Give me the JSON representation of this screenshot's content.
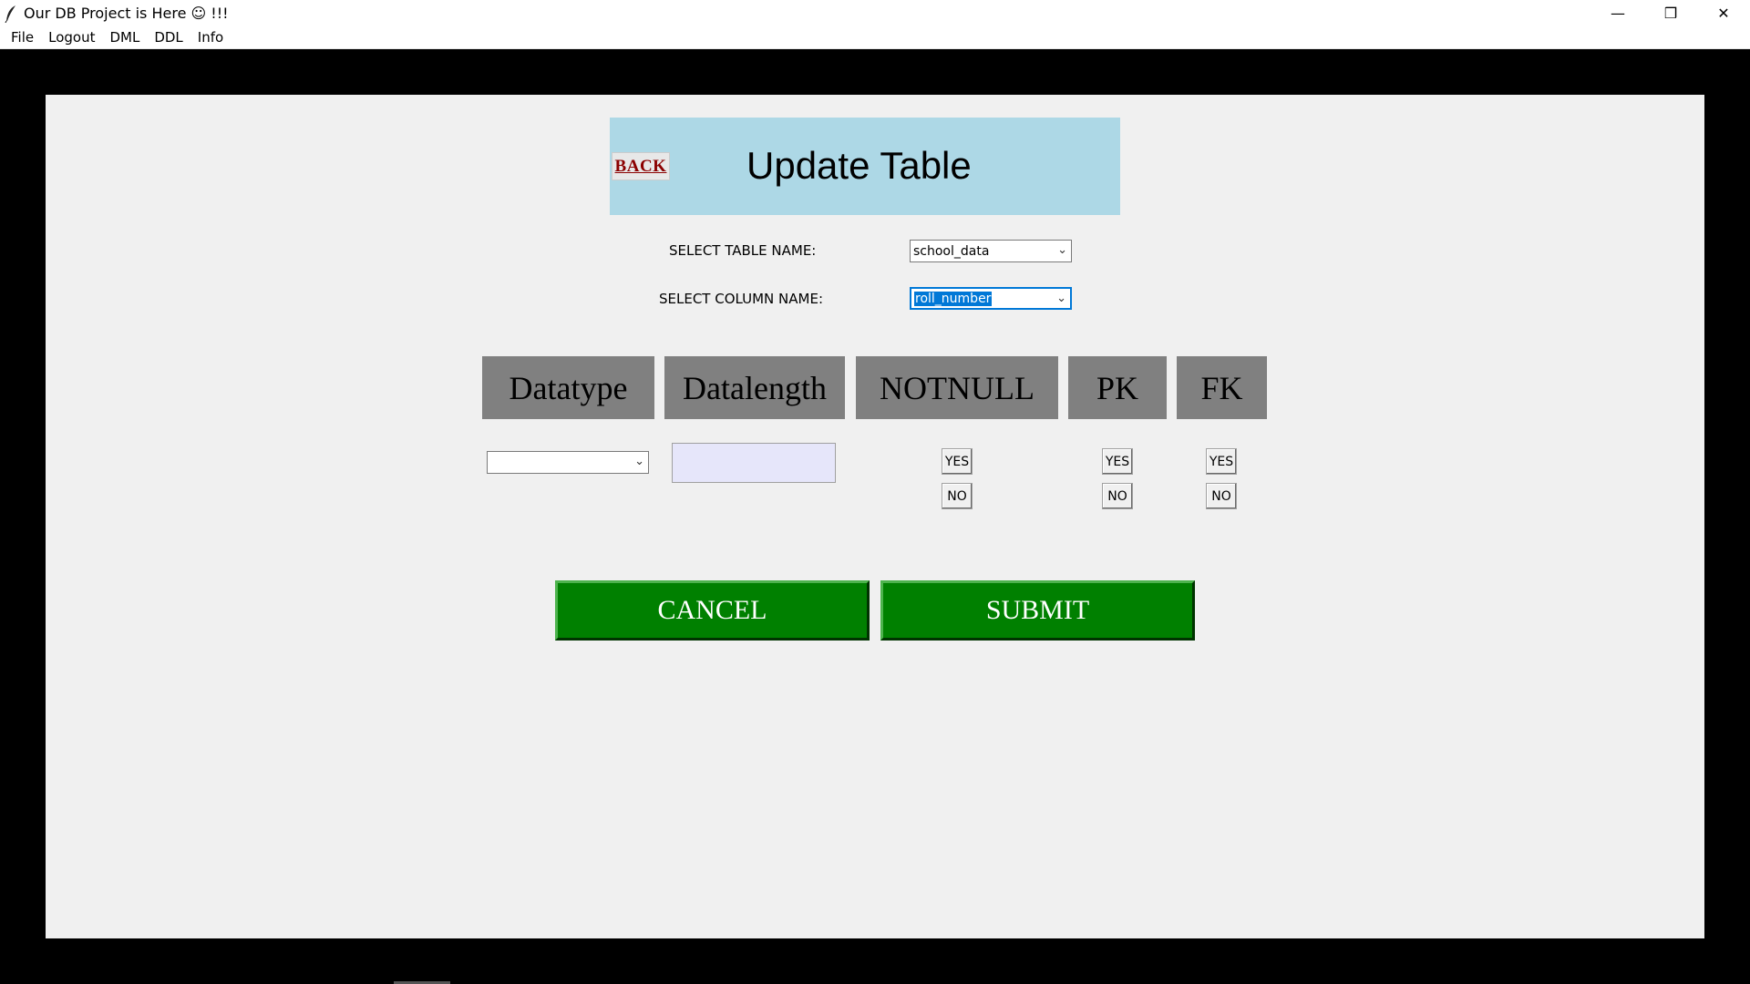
{
  "window": {
    "title": "Our DB Project is Here ☺  !!!",
    "controls": {
      "minimize": "—",
      "restore": "❒",
      "close": "✕"
    }
  },
  "menu": {
    "items": [
      "File",
      "Logout",
      "DML",
      "DDL",
      "Info"
    ]
  },
  "header": {
    "back_label": "BACK",
    "title": "Update Table"
  },
  "form": {
    "table_label": "SELECT TABLE NAME:",
    "table_value": "school_data",
    "column_label": "SELECT COLUMN NAME:",
    "column_value": "roll_number"
  },
  "columns": {
    "datatype": "Datatype",
    "datalength": "Datalength",
    "notnull": "NOTNULL",
    "pk": "PK",
    "fk": "FK"
  },
  "options": {
    "datatype_value": "",
    "datalength_value": "",
    "yes": "YES",
    "no": "NO"
  },
  "actions": {
    "cancel": "CANCEL",
    "submit": "SUBMIT"
  },
  "colors": {
    "header_bg": "#add8e6",
    "action_green": "#008000",
    "column_header_gray": "#808080",
    "panel_bg": "#f0f0f0"
  }
}
